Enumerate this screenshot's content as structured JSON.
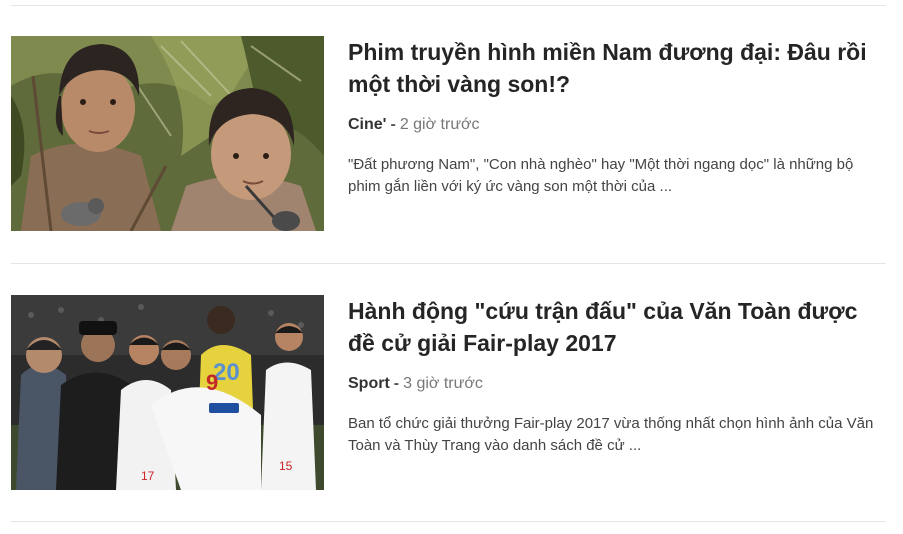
{
  "articles": [
    {
      "title": "Phim truyền hình miền Nam đương đại: Đâu rồi một thời vàng son!?",
      "category": "Cine'",
      "separator": "-",
      "time": "2 giờ trước",
      "excerpt": "\"Đất phương Nam\", \"Con nhà nghèo\" hay \"Một thời ngang dọc\" là những bộ phim gắn liền với ký ức vàng son một thời của ..."
    },
    {
      "title": "Hành động \"cứu trận đấu\" của Văn Toàn được đề cử giải Fair-play 2017",
      "category": "Sport",
      "separator": "-",
      "time": "3 giờ trước",
      "excerpt": "Ban tổ chức giải thưởng Fair-play 2017 vừa thống nhất chọn hình ảnh của Văn Toàn và Thùy Trang vào danh sách đề cử ..."
    }
  ],
  "jersey_numbers": [
    "9",
    "20",
    "17",
    "15"
  ],
  "colors": {
    "title": "#252525",
    "category": "#333333",
    "meta": "#777777",
    "excerpt": "#444444",
    "divider": "#e6e6e6"
  }
}
